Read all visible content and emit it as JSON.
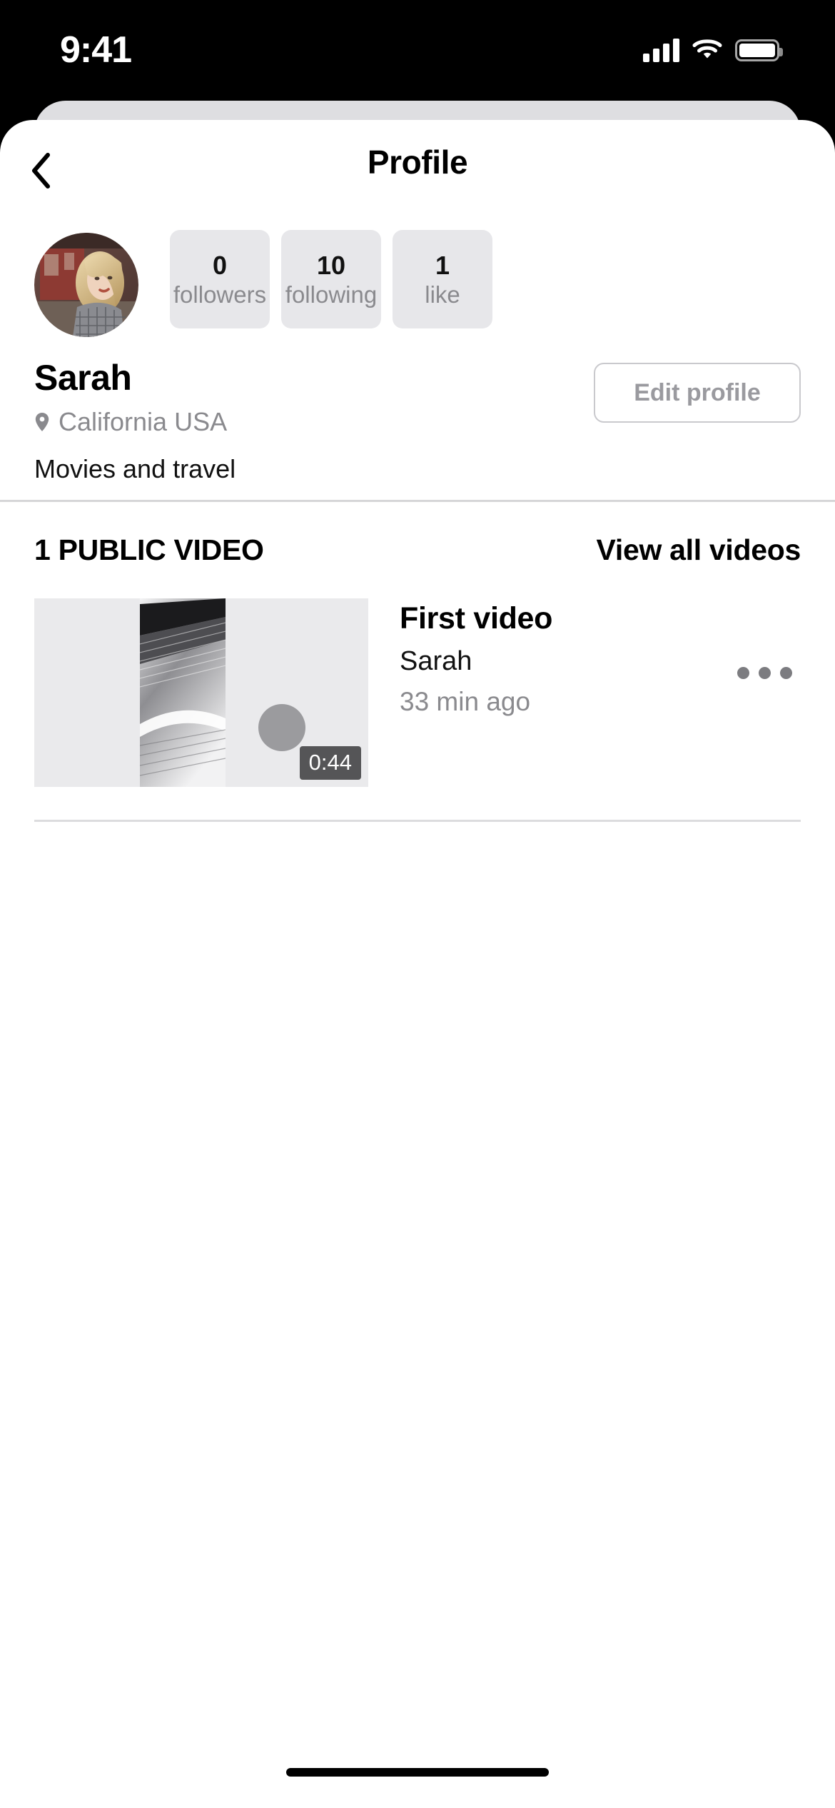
{
  "status_bar": {
    "time": "9:41",
    "icons": [
      "cellular-signal-icon",
      "wifi-icon",
      "battery-icon"
    ]
  },
  "nav": {
    "back_icon": "chevron-left-icon",
    "title": "Profile"
  },
  "profile": {
    "avatar_alt": "user-avatar",
    "name": "Sarah",
    "location_icon": "location-pin-icon",
    "location": "California USA",
    "bio": "Movies and travel",
    "edit_button": "Edit profile",
    "stats": [
      {
        "value": "0",
        "label": "followers"
      },
      {
        "value": "10",
        "label": "following"
      },
      {
        "value": "1",
        "label": "like"
      }
    ]
  },
  "videos_section": {
    "title": "1 PUBLIC VIDEO",
    "view_all": "View all videos",
    "items": [
      {
        "title": "First video",
        "author": "Sarah",
        "timestamp": "33 min ago",
        "duration": "0:44",
        "more_icon": "more-horizontal-icon"
      }
    ]
  },
  "colors": {
    "stat_chip_bg": "#e7e7ea",
    "muted_text": "#8a8a8e",
    "divider": "#d6d6d8",
    "duration_badge_bg": "#3c3c3e",
    "sheet_back": "#dedee1"
  }
}
